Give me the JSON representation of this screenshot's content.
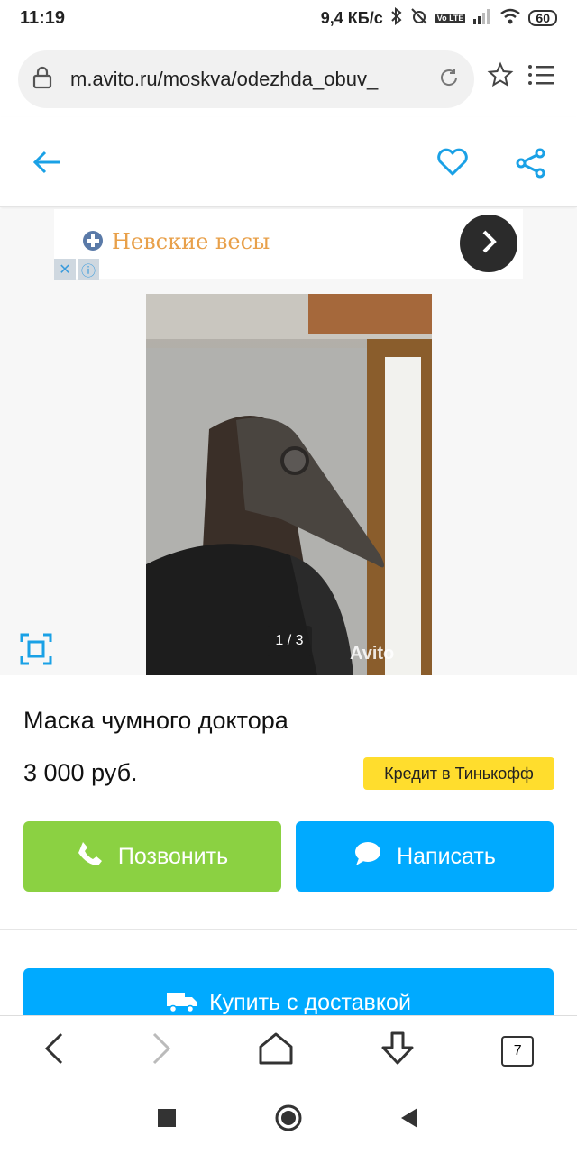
{
  "status_bar": {
    "time": "11:19",
    "speed": "9,4 КБ/с",
    "battery": "60",
    "network_label": "Vo LTE"
  },
  "browser": {
    "url": "m.avito.ru/moskva/odezhda_obuv_",
    "tabs_count": "7"
  },
  "ad": {
    "title": "Невские весы",
    "close_symbol": "✕",
    "info_symbol": "ⓘ"
  },
  "gallery": {
    "counter": "1 / 3",
    "watermark": "Avito"
  },
  "item": {
    "title": "Маска чумного доктора",
    "price": "3 000 руб.",
    "credit_label": "Кредит в Тинькофф"
  },
  "actions": {
    "call_label": "Позвонить",
    "write_label": "Написать",
    "delivery_label": "Купить с доставкой"
  },
  "colors": {
    "accent": "#00aaff",
    "call": "#8bd142",
    "credit": "#ffdd2d"
  }
}
